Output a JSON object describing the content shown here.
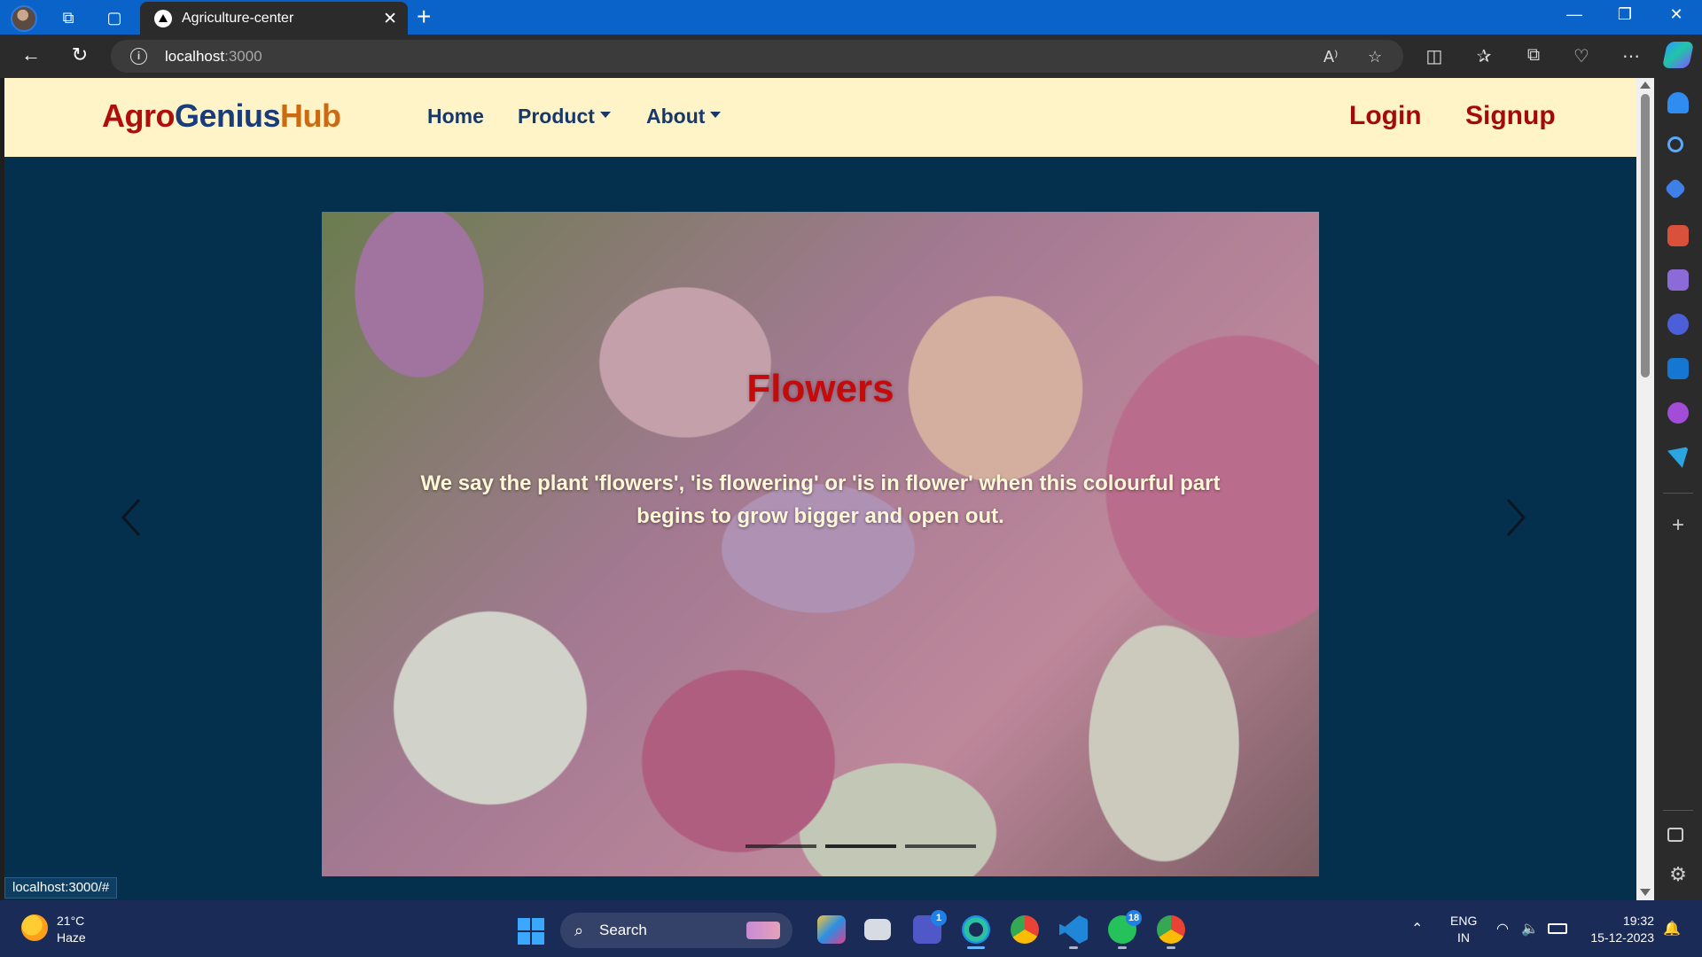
{
  "browser": {
    "tab_title": "Agriculture-center",
    "url_host": "localhost",
    "url_port": ":3000",
    "status_url": "localhost:3000/#"
  },
  "navbar": {
    "brand_part1": "Agro",
    "brand_part2": "Genius",
    "brand_part3": "Hub",
    "links": [
      {
        "label": "Home"
      },
      {
        "label": "Product"
      },
      {
        "label": "About"
      }
    ],
    "login_label": "Login",
    "signup_label": "Signup"
  },
  "carousel": {
    "title": "Flowers",
    "text": "We say the plant 'flowers', 'is flowering' or 'is in flower' when this colourful part begins to grow bigger and open out.",
    "slide_count": 3,
    "active_index": 1
  },
  "taskbar": {
    "weather_temp": "21°C",
    "weather_desc": "Haze",
    "search_label": "Search",
    "teams_badge": "1",
    "whatsapp_badge": "18",
    "lang_line1": "ENG",
    "lang_line2": "IN",
    "time": "19:32",
    "date": "15-12-2023"
  },
  "colors": {
    "page_bg": "#042f4d",
    "navbar_bg": "#fff4c8",
    "brand_red": "#b00d0d",
    "brand_blue": "#1a3c7a",
    "brand_orange": "#cc6a12",
    "slide_title": "#c40a0a"
  }
}
